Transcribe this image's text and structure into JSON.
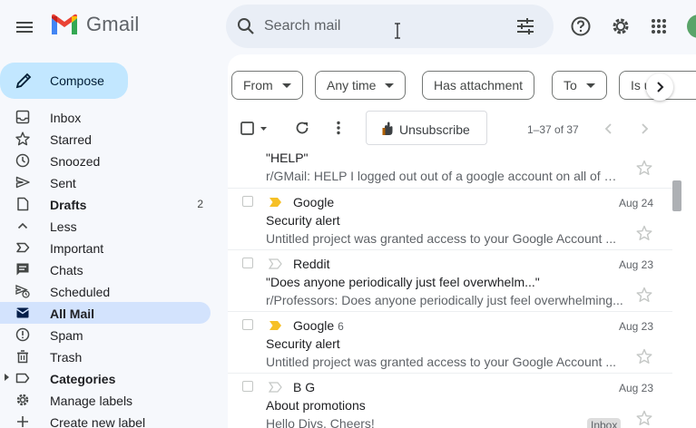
{
  "app": {
    "name": "Gmail"
  },
  "search": {
    "placeholder": "Search mail"
  },
  "sidebar": {
    "compose_label": "Compose",
    "items": [
      {
        "label": "Inbox",
        "icon": "inbox-icon"
      },
      {
        "label": "Starred",
        "icon": "star-icon"
      },
      {
        "label": "Snoozed",
        "icon": "clock-icon"
      },
      {
        "label": "Sent",
        "icon": "send-icon"
      },
      {
        "label": "Drafts",
        "icon": "draft-icon",
        "count": "2"
      },
      {
        "label": "Less",
        "icon": "chevron-up-icon"
      },
      {
        "label": "Important",
        "icon": "important-icon"
      },
      {
        "label": "Chats",
        "icon": "chat-icon"
      },
      {
        "label": "Scheduled",
        "icon": "scheduled-send-icon"
      },
      {
        "label": "All Mail",
        "icon": "all-mail-icon"
      },
      {
        "label": "Spam",
        "icon": "spam-icon"
      },
      {
        "label": "Trash",
        "icon": "trash-icon"
      },
      {
        "label": "Categories",
        "icon": "label-icon"
      },
      {
        "label": "Manage labels",
        "icon": "gear-icon"
      },
      {
        "label": "Create new label",
        "icon": "plus-icon"
      }
    ]
  },
  "filters": {
    "from": "From",
    "any_time": "Any time",
    "has_attachment": "Has attachment",
    "to": "To",
    "is_unread": "Is u"
  },
  "toolbar": {
    "unsubscribe_label": "Unsubscribe",
    "page_range": "1–37 of 37"
  },
  "emails": [
    {
      "sender": "",
      "thread_count": "",
      "date": "",
      "subject": "\"HELP\"",
      "snippet": "r/GMail: HELP I logged out out of a google account on all of my devices...",
      "important": false,
      "label": ""
    },
    {
      "sender": "Google",
      "thread_count": "",
      "date": "Aug 24",
      "subject": "Security alert",
      "snippet": "Untitled project was granted access to your Google Account ...",
      "important": true,
      "label": ""
    },
    {
      "sender": "Reddit",
      "thread_count": "",
      "date": "Aug 23",
      "subject": "\"Does anyone periodically just feel overwhelm...\"",
      "snippet": "r/Professors: Does anyone periodically just feel overwhelming...",
      "important": false,
      "label": ""
    },
    {
      "sender": "Google",
      "thread_count": "6",
      "date": "Aug 23",
      "subject": "Security alert",
      "snippet": "Untitled project was granted access to your Google Account ...",
      "important": true,
      "label": ""
    },
    {
      "sender": "B G",
      "thread_count": "",
      "date": "Aug 23",
      "subject": "About promotions",
      "snippet": "Hello Divs, Cheers!",
      "important": false,
      "label": "Inbox"
    }
  ],
  "colors": {
    "accent": "#c2e7ff",
    "active_nav": "#d3e3fd",
    "important_marker": "#f6c026"
  }
}
